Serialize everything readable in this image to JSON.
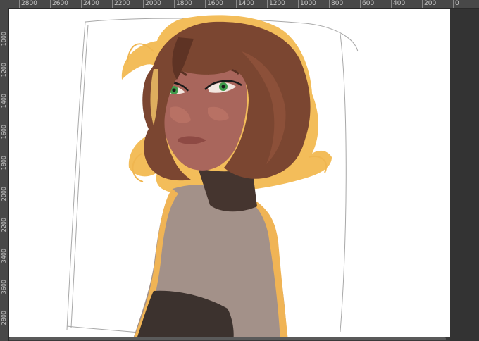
{
  "app": {
    "name": "Painting canvas"
  },
  "ruler": {
    "horizontal": [
      "2800",
      "2600",
      "2400",
      "2200",
      "2000",
      "1800",
      "1600",
      "1400",
      "1200",
      "1000",
      "800",
      "600",
      "400",
      "200",
      "0"
    ],
    "vertical": [
      "1000",
      "1200",
      "1400",
      "1600",
      "1800",
      "2000",
      "2200",
      "3400",
      "3600",
      "2800"
    ]
  },
  "canvas": {
    "artwork": "digital-painting-girl-looking-over-shoulder",
    "colors": {
      "background": "#ffffff",
      "hair": "#7a4530",
      "hair_rim_light": "#f5c160",
      "skin": "#a8655a",
      "eyes": "#3f9a4a",
      "shirt": "#a09088",
      "sleeve": "#3a302c",
      "sketch_lines": "#9a9a9a"
    }
  }
}
